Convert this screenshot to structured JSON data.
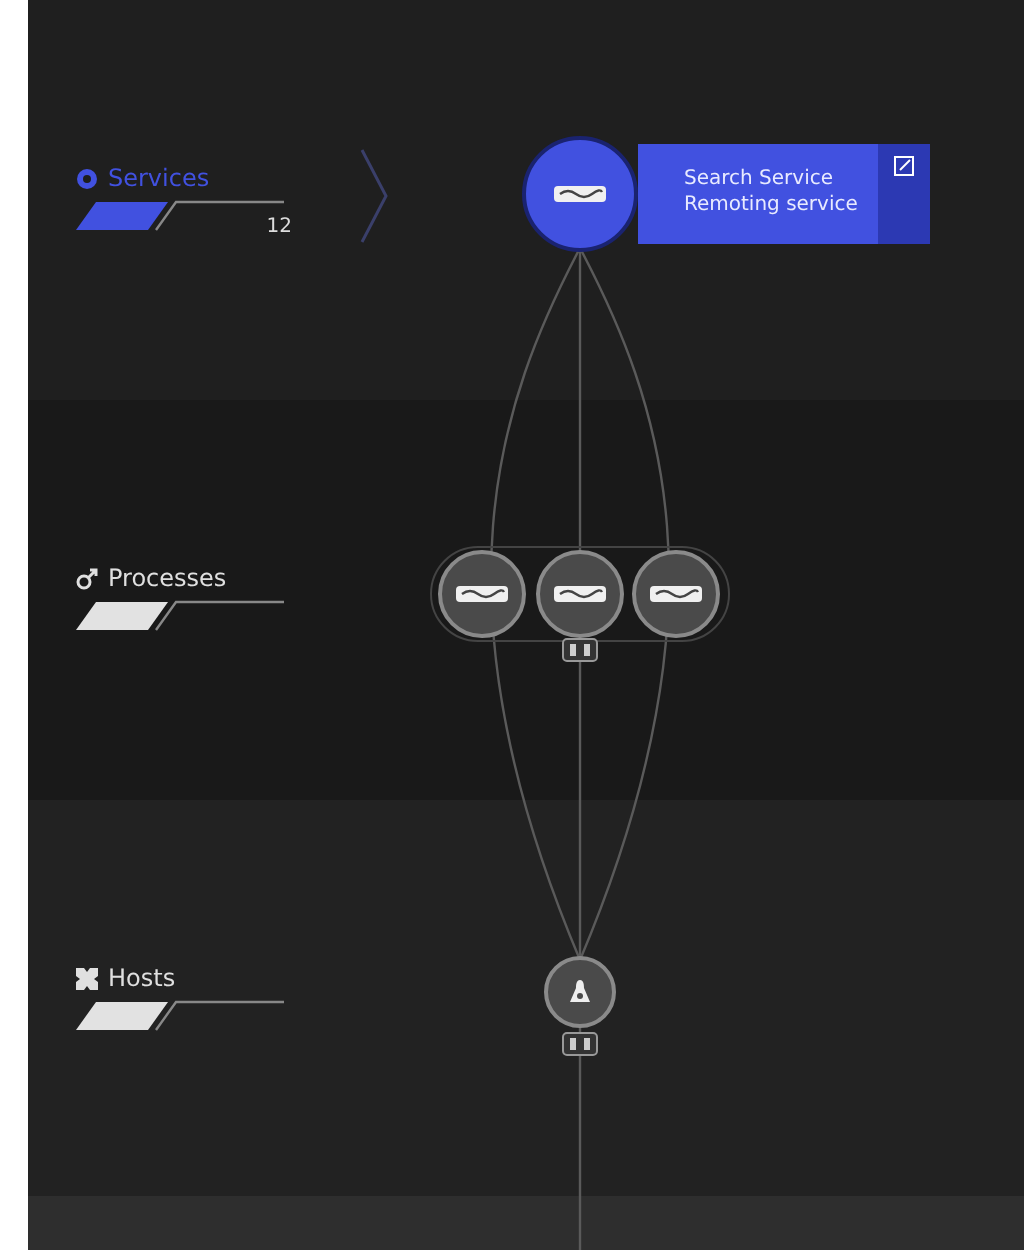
{
  "layers": [
    {
      "kind": "services",
      "label": "Services",
      "selected": true,
      "count": "12"
    },
    {
      "kind": "processes",
      "label": "Processes",
      "selected": false
    },
    {
      "kind": "hosts",
      "label": "Hosts",
      "selected": false
    }
  ],
  "service_node": {
    "title": "Search Service",
    "subtitle": "Remoting service"
  }
}
